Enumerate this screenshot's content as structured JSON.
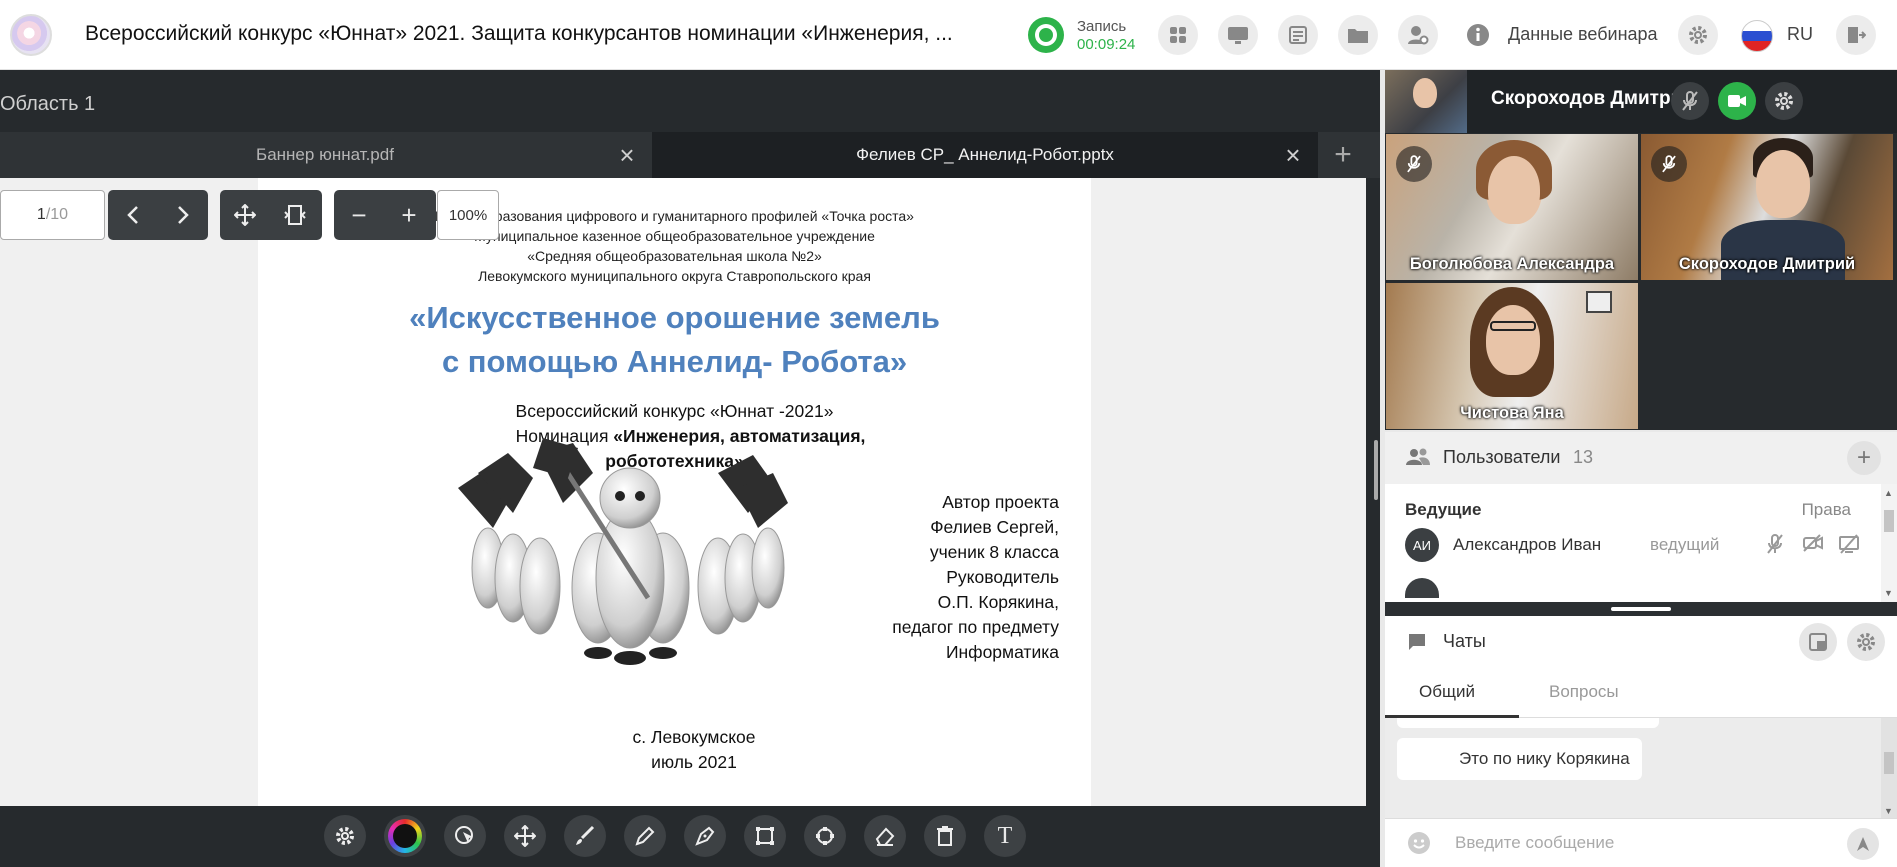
{
  "header": {
    "title": "Всероссийский конкурс «Юннат» 2021. Защита конкурсантов номинации «Инженерия, ...",
    "record_label": "Запись",
    "record_time": "00:09:24",
    "webinar_data": "Данные вебинара",
    "language": "RU",
    "icons": [
      "apps-icon",
      "screen-share-icon",
      "document-icon",
      "folder-icon",
      "user-settings-icon",
      "info-icon",
      "gear-icon",
      "exit-icon"
    ]
  },
  "stage": {
    "area_label": "Область 1",
    "tabs": [
      {
        "label": "Баннер юннат.pdf",
        "active": false
      },
      {
        "label": "Фелиев СР_ Аннелид-Робот.pptx",
        "active": true
      }
    ],
    "toolbar": {
      "page_current": "1",
      "page_total": "/10",
      "zoom": "100%"
    }
  },
  "slide": {
    "header_lines": [
      "Центр образования цифрового и гуманитарного профилей «Точка роста»",
      "Муниципальное казенное общеобразовательное учреждение",
      "«Средняя общеобразовательная школа №2»",
      "Левокумского муниципального округа Ставропольского края"
    ],
    "title_line1": "«Искусственное орошение земель",
    "title_line2": "с помощью Аннелид- Робота»",
    "contest": "Всероссийский конкурс «Юннат -2021»",
    "nomination_prefix": "Номинация ",
    "nomination_bold1": "«Инженерия, автоматизация,",
    "nomination_bold2": "робототехника»",
    "author_lines": [
      "Автор проекта",
      "Фелиев Сергей,",
      "ученик 8 класса",
      "Руководитель",
      "О.П. Корякина,",
      "педагог по предмету",
      "Информатика"
    ],
    "place": "с. Левокумское",
    "date": "июль 2021"
  },
  "participants": {
    "host_name": "Скороходов Дмитрий",
    "videos": [
      {
        "name": "Боголюбова Александра"
      },
      {
        "name": "Скороходов Дмитрий"
      },
      {
        "name": "Чистова Яна"
      }
    ]
  },
  "users": {
    "title": "Пользователи",
    "count": "13",
    "section": "Ведущие",
    "rights_label": "Права",
    "list": [
      {
        "initials": "АИ",
        "name": "Александров Иван",
        "role": "ведущий"
      }
    ]
  },
  "chat": {
    "title": "Чаты",
    "tabs": [
      "Общий",
      "Вопросы"
    ],
    "messages": [
      "Это по нику Корякина"
    ],
    "input_placeholder": "Введите сообщение"
  },
  "colors": {
    "accent_green": "#2db34a",
    "slide_title_blue": "#4f81bd",
    "dark_bg": "#262a2d"
  }
}
